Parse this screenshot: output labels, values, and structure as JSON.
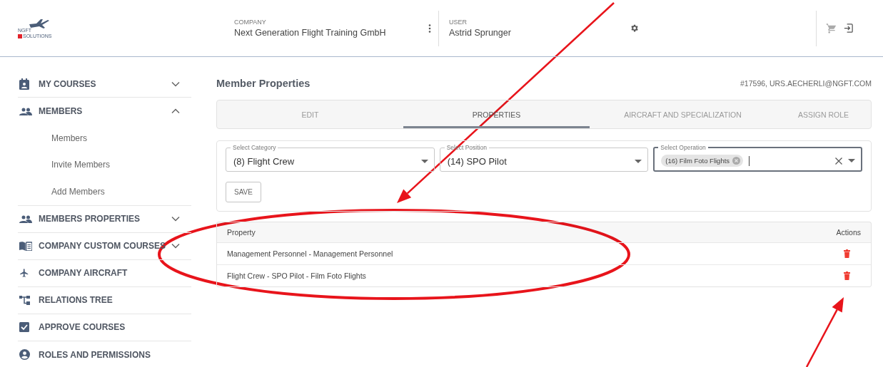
{
  "header": {
    "logo": {
      "line1": "NGFT",
      "line2": "SOLUTIONS"
    },
    "company": {
      "label": "COMPANY",
      "value": "Next Generation Flight Training GmbH"
    },
    "user": {
      "label": "USER",
      "value": "Astrid Sprunger"
    }
  },
  "sidebar": {
    "items": [
      {
        "label": "MY COURSES",
        "kind": "group",
        "expanded": false
      },
      {
        "label": "MEMBERS",
        "kind": "group",
        "expanded": true,
        "children": [
          {
            "label": "Members"
          },
          {
            "label": "Invite Members"
          },
          {
            "label": "Add Members"
          }
        ]
      },
      {
        "label": "MEMBERS PROPERTIES",
        "kind": "group",
        "expanded": false
      },
      {
        "label": "COMPANY CUSTOM COURSES",
        "kind": "group",
        "expanded": false
      },
      {
        "label": "COMPANY AIRCRAFT",
        "kind": "link"
      },
      {
        "label": "RELATIONS TREE",
        "kind": "link"
      },
      {
        "label": "APPROVE COURSES",
        "kind": "link"
      },
      {
        "label": "ROLES AND PERMISSIONS",
        "kind": "link"
      }
    ]
  },
  "page": {
    "title": "Member Properties",
    "member_info": "#17596, URS.AECHERLI@NGFT.COM"
  },
  "tabs": [
    {
      "label": "EDIT",
      "selected": false
    },
    {
      "label": "PROPERTIES",
      "selected": true
    },
    {
      "label": "AIRCRAFT AND SPECIALIZATION",
      "selected": false
    },
    {
      "label": "ASSIGN ROLE",
      "selected": false
    }
  ],
  "form": {
    "fields": [
      {
        "label": "Select Category",
        "kind": "select",
        "value": "(8) Flight Crew",
        "focused": false
      },
      {
        "label": "Select Position",
        "kind": "select",
        "value": "(14) SPO Pilot",
        "focused": false
      },
      {
        "label": "Select Operation",
        "kind": "multiselect",
        "chips": [
          "(16) Film Foto Flights"
        ],
        "focused": true
      }
    ],
    "save_button": "SAVE"
  },
  "table": {
    "columns": [
      "Property",
      "Actions"
    ],
    "rows": [
      {
        "property": "Management Personnel - Management Personnel"
      },
      {
        "property": "Flight Crew - SPO Pilot - Film Foto Flights"
      }
    ]
  },
  "annotations": [
    {
      "kind": "arrow"
    },
    {
      "kind": "ellipse"
    },
    {
      "kind": "arrow"
    }
  ]
}
